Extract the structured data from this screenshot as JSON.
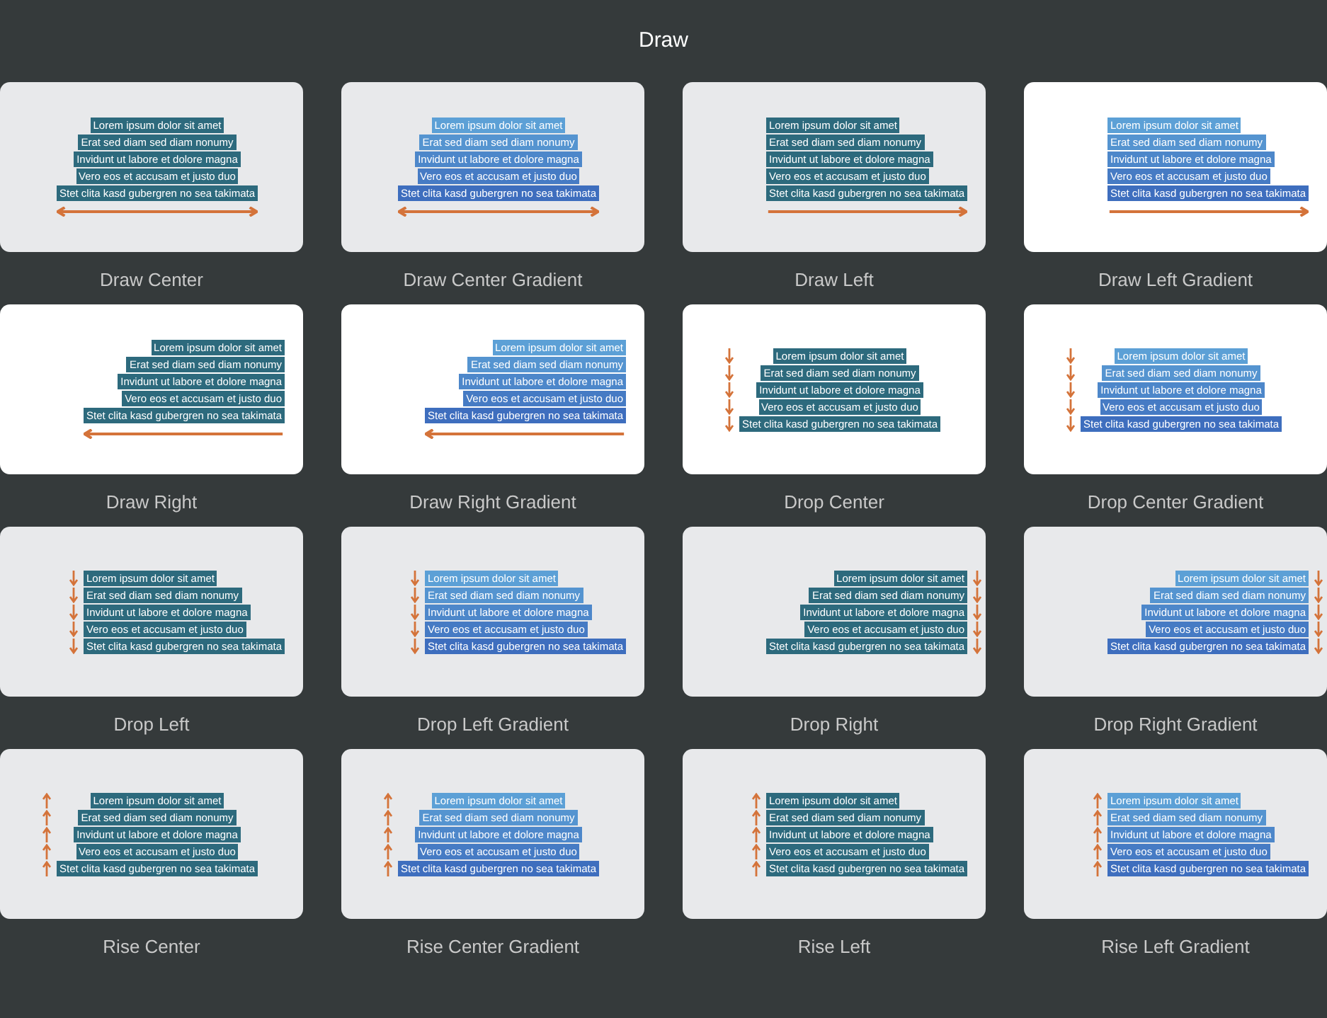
{
  "title": "Draw",
  "tiles": [
    {
      "label": "Draw Center",
      "kind": "draw-center",
      "gradient": false,
      "selected": false,
      "lines": [
        "Lorem ipsum dolor sit amet",
        "Erat sed diam sed diam nonumy",
        "Invidunt ut labore et dolore magna",
        "Vero eos et accusam et justo duo",
        "Stet clita kasd gubergren no sea takimata"
      ]
    },
    {
      "label": "Draw Center Gradient",
      "kind": "draw-center",
      "gradient": true,
      "selected": false,
      "lines": [
        "Lorem ipsum dolor sit amet",
        "Erat sed diam sed diam nonumy",
        "Invidunt ut labore et dolore magna",
        "Vero eos et accusam et justo duo",
        "Stet clita kasd gubergren no sea takimata"
      ]
    },
    {
      "label": "Draw Left",
      "kind": "draw-left",
      "gradient": false,
      "selected": false,
      "lines": [
        "Lorem ipsum dolor sit amet",
        "Erat sed diam sed diam nonumy",
        "Invidunt ut labore et dolore magna",
        "Vero eos et accusam et justo duo",
        "Stet clita kasd gubergren no sea takimata"
      ]
    },
    {
      "label": "Draw Left Gradient",
      "kind": "draw-left",
      "gradient": true,
      "selected": true,
      "lines": [
        "Lorem ipsum dolor sit amet",
        "Erat sed diam sed diam nonumy",
        "Invidunt ut labore et dolore magna",
        "Vero eos et accusam et justo duo",
        "Stet clita kasd gubergren no sea takimata"
      ]
    },
    {
      "label": "Draw Right",
      "kind": "draw-right",
      "gradient": false,
      "selected": true,
      "lines": [
        "Lorem ipsum dolor sit amet",
        "Erat sed diam sed diam nonumy",
        "Invidunt ut labore et dolore magna",
        "Vero eos et accusam et justo duo",
        "Stet clita kasd gubergren no sea takimata"
      ]
    },
    {
      "label": "Draw Right Gradient",
      "kind": "draw-right",
      "gradient": true,
      "selected": true,
      "lines": [
        "Lorem ipsum dolor sit amet",
        "Erat sed diam sed diam nonumy",
        "Invidunt ut labore et dolore magna",
        "Vero eos et accusam et justo duo",
        "Stet clita kasd gubergren no sea takimata"
      ]
    },
    {
      "label": "Drop Center",
      "kind": "drop-center",
      "gradient": false,
      "selected": true,
      "lines": [
        "Lorem ipsum dolor sit amet",
        "Erat sed diam sed diam nonumy",
        "Invidunt ut labore et dolore magna",
        "Vero eos et accusam et justo duo",
        "Stet clita kasd gubergren no sea takimata"
      ]
    },
    {
      "label": "Drop Center Gradient",
      "kind": "drop-center",
      "gradient": true,
      "selected": true,
      "lines": [
        "Lorem ipsum dolor sit amet",
        "Erat sed diam sed diam nonumy",
        "Invidunt ut labore et dolore magna",
        "Vero eos et accusam et justo duo",
        "Stet clita kasd gubergren no sea takimata"
      ]
    },
    {
      "label": "Drop Left",
      "kind": "drop-left",
      "gradient": false,
      "selected": false,
      "lines": [
        "Lorem ipsum dolor sit amet",
        "Erat sed diam sed diam nonumy",
        "Invidunt ut labore et dolore magna",
        "Vero eos et accusam et justo duo",
        "Stet clita kasd gubergren no sea takimata"
      ]
    },
    {
      "label": "Drop Left Gradient",
      "kind": "drop-left",
      "gradient": true,
      "selected": false,
      "lines": [
        "Lorem ipsum dolor sit amet",
        "Erat sed diam sed diam nonumy",
        "Invidunt ut labore et dolore magna",
        "Vero eos et accusam et justo duo",
        "Stet clita kasd gubergren no sea takimata"
      ]
    },
    {
      "label": "Drop Right",
      "kind": "drop-right",
      "gradient": false,
      "selected": false,
      "lines": [
        "Lorem ipsum dolor sit amet",
        "Erat sed diam sed diam nonumy",
        "Invidunt ut labore et dolore magna",
        "Vero eos et accusam et justo duo",
        "Stet clita kasd gubergren no sea takimata"
      ]
    },
    {
      "label": "Drop Right Gradient",
      "kind": "drop-right",
      "gradient": true,
      "selected": false,
      "lines": [
        "Lorem ipsum dolor sit amet",
        "Erat sed diam sed diam nonumy",
        "Invidunt ut labore et dolore magna",
        "Vero eos et accusam et justo duo",
        "Stet clita kasd gubergren no sea takimata"
      ]
    },
    {
      "label": "Rise Center",
      "kind": "rise-center",
      "gradient": false,
      "selected": false,
      "lines": [
        "Lorem ipsum dolor sit amet",
        "Erat sed diam sed diam nonumy",
        "Invidunt ut labore et dolore magna",
        "Vero eos et accusam et justo duo",
        "Stet clita kasd gubergren no sea takimata"
      ]
    },
    {
      "label": "Rise Center Gradient",
      "kind": "rise-center",
      "gradient": true,
      "selected": false,
      "lines": [
        "Lorem ipsum dolor sit amet",
        "Erat sed diam sed diam nonumy",
        "Invidunt ut labore et dolore magna",
        "Vero eos et accusam et justo duo",
        "Stet clita kasd gubergren no sea takimata"
      ]
    },
    {
      "label": "Rise Left",
      "kind": "rise-left",
      "gradient": false,
      "selected": false,
      "lines": [
        "Lorem ipsum dolor sit amet",
        "Erat sed diam sed diam nonumy",
        "Invidunt ut labore et dolore magna",
        "Vero eos et accusam et justo duo",
        "Stet clita kasd gubergren no sea takimata"
      ]
    },
    {
      "label": "Rise Left Gradient",
      "kind": "rise-left",
      "gradient": true,
      "selected": false,
      "lines": [
        "Lorem ipsum dolor sit amet",
        "Erat sed diam sed diam nonumy",
        "Invidunt ut labore et dolore magna",
        "Vero eos et accusam et justo duo",
        "Stet clita kasd gubergren no sea takimata"
      ]
    }
  ]
}
